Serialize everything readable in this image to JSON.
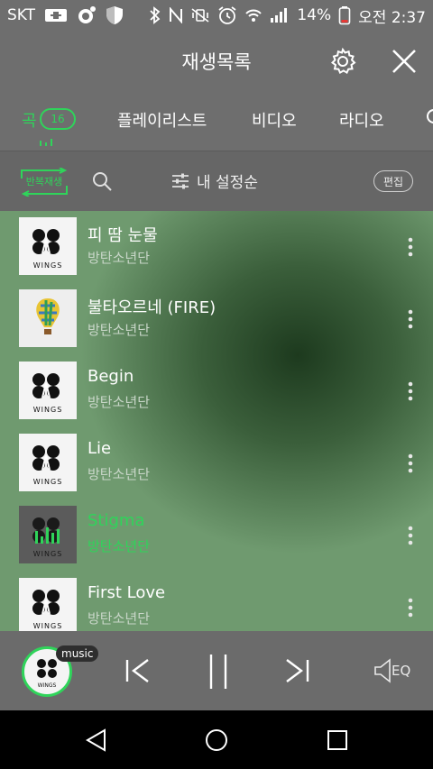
{
  "status_bar": {
    "carrier": "SKT",
    "battery": "14%",
    "time": "오전 2:37"
  },
  "header": {
    "title": "재생목록"
  },
  "tabs": [
    {
      "label": "곡",
      "badge": "16",
      "active": true
    },
    {
      "label": "플레이리스트"
    },
    {
      "label": "비디오"
    },
    {
      "label": "라디오"
    }
  ],
  "toolbar": {
    "repeat_label": "반복재생",
    "sort_label": "내 설정순",
    "edit_label": "편집"
  },
  "songs": [
    {
      "title": "피 땀 눈물",
      "artist": "방탄소년단",
      "art": "wings"
    },
    {
      "title": "불타오르네 (FIRE)",
      "artist": "방탄소년단",
      "art": "balloon"
    },
    {
      "title": "Begin",
      "artist": "방탄소년단",
      "art": "wings"
    },
    {
      "title": "Lie",
      "artist": "방탄소년단",
      "art": "wings"
    },
    {
      "title": "Stigma",
      "artist": "방탄소년단",
      "art": "wings",
      "playing": true
    },
    {
      "title": "First Love",
      "artist": "방탄소년단",
      "art": "wings"
    }
  ],
  "player": {
    "tag": "music",
    "eq_label": "EQ"
  },
  "colors": {
    "accent": "#2fd45a",
    "header_bg": "#6e6e6e",
    "player_bg": "#6b6b6b"
  }
}
